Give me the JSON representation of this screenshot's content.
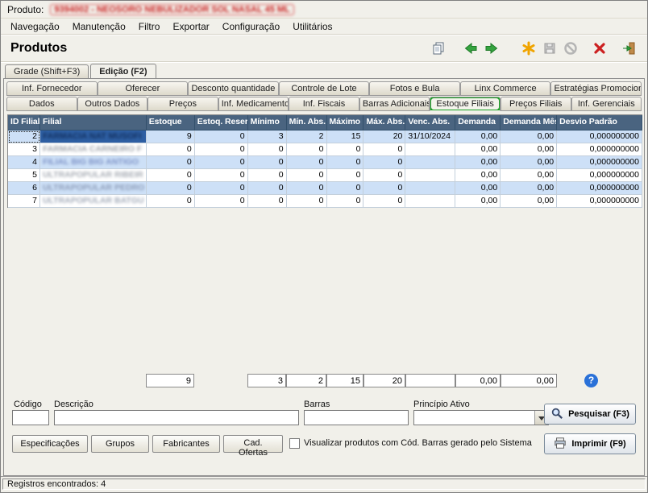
{
  "window": {
    "product_label": "Produto:",
    "product_value": "9394002 - NEOSORO NEBULIZADOR SOL NASAL 45 ML",
    "title": "Produtos",
    "status": "Registros encontrados: 4"
  },
  "menu": {
    "items": [
      "Navegação",
      "Manutenção",
      "Filtro",
      "Exportar",
      "Configuração",
      "Utilitários"
    ]
  },
  "toolbar": {
    "icons": [
      "copy-icon",
      "nav-back-icon",
      "nav-forward-icon",
      "new-record-icon",
      "save-icon",
      "cancel-icon",
      "delete-icon",
      "exit-icon"
    ]
  },
  "tabs_top": {
    "grade": "Grade (Shift+F3)",
    "edicao": "Edição (F2)"
  },
  "tabs_row1": [
    "Inf. Fornecedor",
    "Oferecer",
    "Desconto quantidade",
    "Controle de Lote",
    "Fotos e Bula",
    "Linx Commerce",
    "Estratégias Promocionais"
  ],
  "tabs_row2": [
    "Dados",
    "Outros Dados",
    "Preços",
    "Inf. Medicamento",
    "Inf. Fiscais",
    "Barras Adicionais",
    "Estoque Filiais",
    "Preços Filiais",
    "Inf. Gerenciais"
  ],
  "table": {
    "columns": [
      "ID Filial",
      "Filial",
      "Estoque",
      "Estoq. Reser.",
      "Mínimo",
      "Mín. Abs.",
      "Máximo",
      "Máx. Abs.",
      "Venc. Abs.",
      "Demanda",
      "Demanda Mês",
      "Desvio Padrão"
    ],
    "rows": [
      [
        "2",
        "FARMACIA NAT MUSOFI",
        "9",
        "0",
        "3",
        "2",
        "15",
        "20",
        "31/10/2024",
        "0,00",
        "0,00",
        "0,000000000"
      ],
      [
        "3",
        "FARMACIA CARNEIRO F",
        "0",
        "0",
        "0",
        "0",
        "0",
        "0",
        "",
        "0,00",
        "0,00",
        "0,000000000"
      ],
      [
        "4",
        "FILIAL BIG BIG ANTIGO",
        "0",
        "0",
        "0",
        "0",
        "0",
        "0",
        "",
        "0,00",
        "0,00",
        "0,000000000"
      ],
      [
        "5",
        "ULTRAPOPULAR RIBEIR",
        "0",
        "0",
        "0",
        "0",
        "0",
        "0",
        "",
        "0,00",
        "0,00",
        "0,000000000"
      ],
      [
        "6",
        "ULTRAPOPULAR PEDRO",
        "0",
        "0",
        "0",
        "0",
        "0",
        "0",
        "",
        "0,00",
        "0,00",
        "0,000000000"
      ],
      [
        "7",
        "ULTRAPOPULAR BATGU",
        "0",
        "0",
        "0",
        "0",
        "0",
        "0",
        "",
        "0,00",
        "0,00",
        "0,000000000"
      ]
    ],
    "totals": {
      "estoque": "9",
      "minimo": "3",
      "min_abs": "2",
      "maximo": "15",
      "max_abs": "20",
      "venc": "",
      "demanda": "0,00",
      "demanda_mes": "0,00"
    },
    "help_icon": "?"
  },
  "search": {
    "codigo_label": "Código",
    "descricao_label": "Descrição",
    "barras_label": "Barras",
    "principio_label": "Princípio Ativo",
    "pesquisar_button": "Pesquisar (F3)",
    "imprimir_button": "Imprimir (F9)",
    "spec_button": "Especificações",
    "grupos_button": "Grupos",
    "fabricantes_button": "Fabricantes",
    "ofertas_button": "Cad. Ofertas",
    "checkbox_label": "Visualizar produtos com Cód. Barras gerado pelo Sistema"
  },
  "colors": {
    "header_blue": "#4a6480",
    "row_stripe": "#cde0f7",
    "selected_cell": "#2e5fa3",
    "annotation_green": "#14a01e",
    "redaction_red": "#cc2222"
  }
}
